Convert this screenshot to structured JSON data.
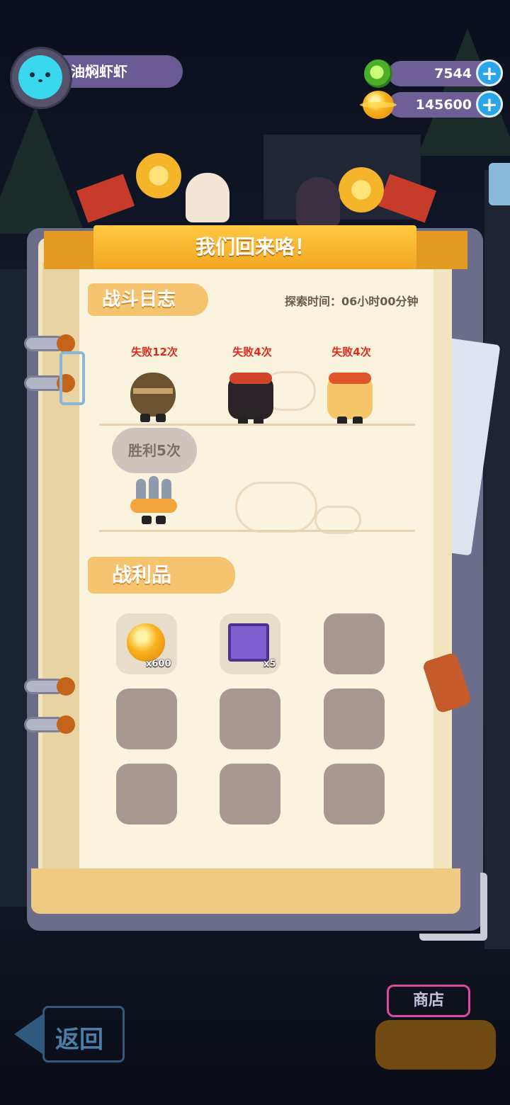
{
  "player": {
    "name": "油焖虾虾",
    "avatar_icon": "cat-face-icon"
  },
  "currencies": [
    {
      "icon": "gem-icon",
      "amount": "7544"
    },
    {
      "icon": "gold-coin-icon",
      "amount": "145600"
    }
  ],
  "banner": {
    "title": "我们回来咯！"
  },
  "battle_log": {
    "label": "战斗日志",
    "explore_time": "探索时间：06小时00分钟",
    "entries": [
      {
        "status": "失败12次",
        "monster": "bandaged-mummy"
      },
      {
        "status": "失败4次",
        "monster": "dark-sushi"
      },
      {
        "status": "失败4次",
        "monster": "orange-sushi"
      },
      {
        "status": "胜利5次",
        "monster": "fish-pie"
      }
    ]
  },
  "loot": {
    "label": "战利品",
    "items": [
      {
        "icon": "gold-coin-icon",
        "count": "x600"
      },
      {
        "icon": "purple-card-icon",
        "count": "x5"
      },
      {
        "icon": "",
        "count": ""
      },
      {
        "icon": "",
        "count": ""
      },
      {
        "icon": "",
        "count": ""
      },
      {
        "icon": "",
        "count": ""
      },
      {
        "icon": "",
        "count": ""
      },
      {
        "icon": "",
        "count": ""
      },
      {
        "icon": "",
        "count": ""
      }
    ]
  },
  "nav": {
    "back_label": "返回",
    "shop_label": "商店"
  },
  "colors": {
    "banner": "#f7b52c",
    "page": "#faf3de",
    "fail": "#e02a1a",
    "empty_slot": "#a79891"
  }
}
